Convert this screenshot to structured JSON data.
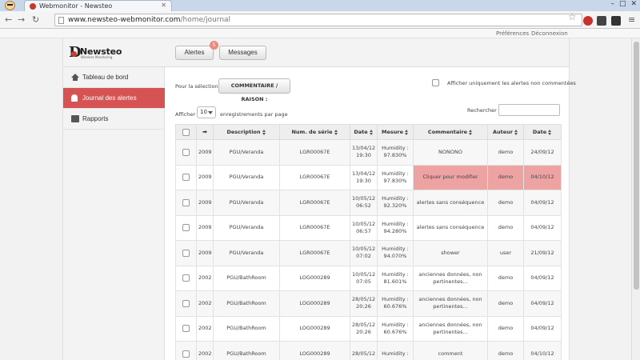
{
  "browser": {
    "tab_title": "Webmonitor - Newsteo",
    "url_host": "www.newsteo-webmonitor.com",
    "url_path": "/home/journal"
  },
  "topbar": {
    "preferences": "Préférences",
    "logout": "Déconnexion"
  },
  "logo": {
    "name": "Newsteo",
    "tagline": "Wireless Monitoring"
  },
  "header": {
    "alerts_label": "Alertes",
    "alerts_badge": "5",
    "messages_label": "Messages"
  },
  "sidebar": {
    "items": [
      {
        "label": "Tableau de bord",
        "icon": "home-icon"
      },
      {
        "label": "Journal des alertes",
        "icon": "bell-icon"
      },
      {
        "label": "Rapports",
        "icon": "printer-icon"
      }
    ],
    "active_index": 1
  },
  "toolbar": {
    "selection_label": "Pour la sélection :",
    "comment_button": "COMMENTAIRE / RAISON :",
    "only_uncommented_label": "Afficher uniquement les alertes non commentées",
    "show_label": "Afficher",
    "page_size": "10",
    "per_page_label": "enregistrements par page",
    "search_label": "Rechercher :",
    "search_value": ""
  },
  "table": {
    "headers": [
      "",
      "",
      "Description",
      "Num. de série",
      "Date",
      "Mesure",
      "Commentaire",
      "Auteur",
      "Date"
    ],
    "rows": [
      {
        "id": "2009",
        "description": "PGU/Veranda",
        "serial": "LGR00067E",
        "date1": "13/04/12",
        "time1": "19:30",
        "measure": "Humidity :",
        "value": "97.830%",
        "comment": "NONONO",
        "author": "demo",
        "date2": "24/09/12",
        "highlight": false
      },
      {
        "id": "2009",
        "description": "PGU/Veranda",
        "serial": "LGR00067E",
        "date1": "13/04/12",
        "time1": "19:30",
        "measure": "Humidity :",
        "value": "97.830%",
        "comment": "Cliquer pour modifier",
        "author": "demo",
        "date2": "04/10/12",
        "highlight": true
      },
      {
        "id": "2009",
        "description": "PGU/Veranda",
        "serial": "LGR00067E",
        "date1": "10/05/12",
        "time1": "06:52",
        "measure": "Humidity :",
        "value": "92.320%",
        "comment": "alertes sans conséquence",
        "author": "demo",
        "date2": "04/09/12",
        "highlight": false
      },
      {
        "id": "2009",
        "description": "PGU/Veranda",
        "serial": "LGR00067E",
        "date1": "10/05/12",
        "time1": "06:57",
        "measure": "Humidity :",
        "value": "94.280%",
        "comment": "alertes sans conséquence",
        "author": "demo",
        "date2": "04/09/12",
        "highlight": false
      },
      {
        "id": "2009",
        "description": "PGU/Veranda",
        "serial": "LGR00067E",
        "date1": "10/05/12",
        "time1": "07:02",
        "measure": "Humidity :",
        "value": "94.070%",
        "comment": "shower",
        "author": "user",
        "date2": "21/09/12",
        "highlight": false
      },
      {
        "id": "2002",
        "description": "PGU/BathRoom",
        "serial": "LOG000289",
        "date1": "10/05/12",
        "time1": "07:05",
        "measure": "Humidity :",
        "value": "81.601%",
        "comment": "anciennes données, non pertinentes...",
        "author": "demo",
        "date2": "04/09/12",
        "highlight": false
      },
      {
        "id": "2002",
        "description": "PGU/BathRoom",
        "serial": "LOG000289",
        "date1": "28/05/12",
        "time1": "20:26",
        "measure": "Humidity :",
        "value": "60.676%",
        "comment": "anciennes données, non pertinentes...",
        "author": "demo",
        "date2": "04/09/12",
        "highlight": false
      },
      {
        "id": "2002",
        "description": "PGU/BathRoom",
        "serial": "LOG000289",
        "date1": "28/05/12",
        "time1": "20:26",
        "measure": "Humidity :",
        "value": "60.676%",
        "comment": "anciennes données, non pertinentes...",
        "author": "demo",
        "date2": "04/09/12",
        "highlight": false
      },
      {
        "id": "2002",
        "description": "PGU/BathRoom",
        "serial": "LOG000289",
        "date1": "28/05/12",
        "time1": "",
        "measure": "Humidity :",
        "value": "",
        "comment": "comment",
        "author": "demo",
        "date2": "04/10/12",
        "highlight": false
      }
    ]
  },
  "colors": {
    "accent": "#d65353",
    "highlight_cell": "#eea3a3"
  }
}
